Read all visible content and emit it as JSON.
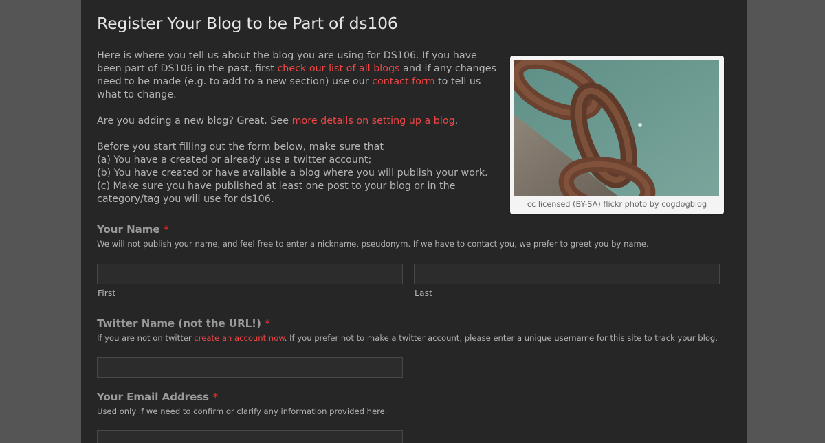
{
  "page": {
    "title": "Register Your Blog to be Part of ds106"
  },
  "intro": {
    "p1_before": "Here is where you tell us about the blog you are using for DS106. If you have been part of DS106 in the past, first ",
    "p1_link1": "check our list of all blogs",
    "p1_middle": " and if any changes need to be made (e.g. to add to a new section) use our ",
    "p1_link2": "contact form",
    "p1_after": " to tell us what to change.",
    "p2_before": "Are you adding a new blog? Great. See ",
    "p2_link": "more details on setting up a blog",
    "p2_after": ".",
    "p3_lines": [
      "Before you start filling out the form below, make sure that",
      "(a) You have a created or already use a twitter account;",
      "(b) You have created or have available a blog where you will publish your work.",
      "(c) Make sure you have published at least one post to your blog or in the category/tag you will use for ds106."
    ]
  },
  "photo": {
    "caption": "cc licensed (BY-SA) flickr photo by cogdogblog"
  },
  "form": {
    "required_mark": "*",
    "name": {
      "label": "Your Name",
      "help": "We will not publish your name, and feel free to enter a nickname, pseudonym. If we have to contact you, we prefer to greet you by name.",
      "first_label": "First",
      "last_label": "Last",
      "first_value": "",
      "last_value": ""
    },
    "twitter": {
      "label": "Twitter Name (not the URL!)",
      "help_before": "If you are not on twitter ",
      "help_link": "create an account now",
      "help_after": ". If you prefer not to make a twitter account, please enter a unique username for this site to track your blog.",
      "value": ""
    },
    "email": {
      "label": "Your Email Address",
      "help": "Used only if we need to confirm or clarify any information provided here.",
      "value": ""
    }
  },
  "colors": {
    "background": "#555555",
    "panel": "#262626",
    "link": "#f04646",
    "required": "#d32b2b"
  }
}
